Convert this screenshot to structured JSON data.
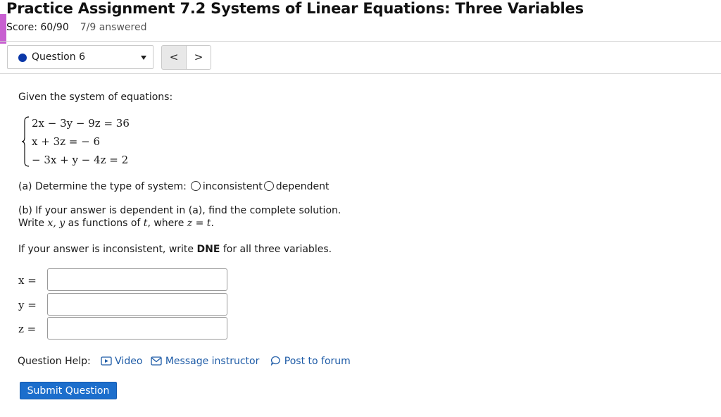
{
  "header": {
    "title": "Practice Assignment 7.2 Systems of Linear Equations: Three Variables",
    "score": "Score: 60/90",
    "answered": "7/9 answered",
    "accent_color": "#c85fd1"
  },
  "nav": {
    "question_select": "Question 6",
    "prev_label": "<",
    "next_label": ">",
    "dot_color": "#0a37a8"
  },
  "question": {
    "prompt": "Given the system of equations:",
    "equations": [
      "2x − 3y − 9z = 36",
      "x + 3z = − 6",
      "− 3x + y − 4z = 2"
    ],
    "part_a": {
      "text": "(a) Determine the type of system:",
      "options": [
        "inconsistent",
        "dependent"
      ]
    },
    "part_b": {
      "line1": "(b) If your answer is dependent in (a), find the complete solution.",
      "line2_prefix": "Write ",
      "line2_vars": "x, y",
      "line2_mid": " as functions of ",
      "line2_t": "t",
      "line2_where": ", where ",
      "line2_eq": "z = t",
      "line2_end": "."
    },
    "dne": {
      "prefix": "If your answer is inconsistent, write ",
      "bold": "DNE",
      "suffix": " for all three variables."
    },
    "inputs": [
      {
        "label": "x =",
        "value": ""
      },
      {
        "label": "y =",
        "value": ""
      },
      {
        "label": "z =",
        "value": ""
      }
    ]
  },
  "help": {
    "label": "Question Help:",
    "video": "Video",
    "message": "Message instructor",
    "forum": "Post to forum",
    "icon_video": "video-icon",
    "icon_message": "envelope-icon",
    "icon_forum": "speech-bubble-icon",
    "link_color": "#1c5aa6"
  },
  "submit": {
    "label": "Submit Question",
    "color": "#1c6ecc"
  }
}
